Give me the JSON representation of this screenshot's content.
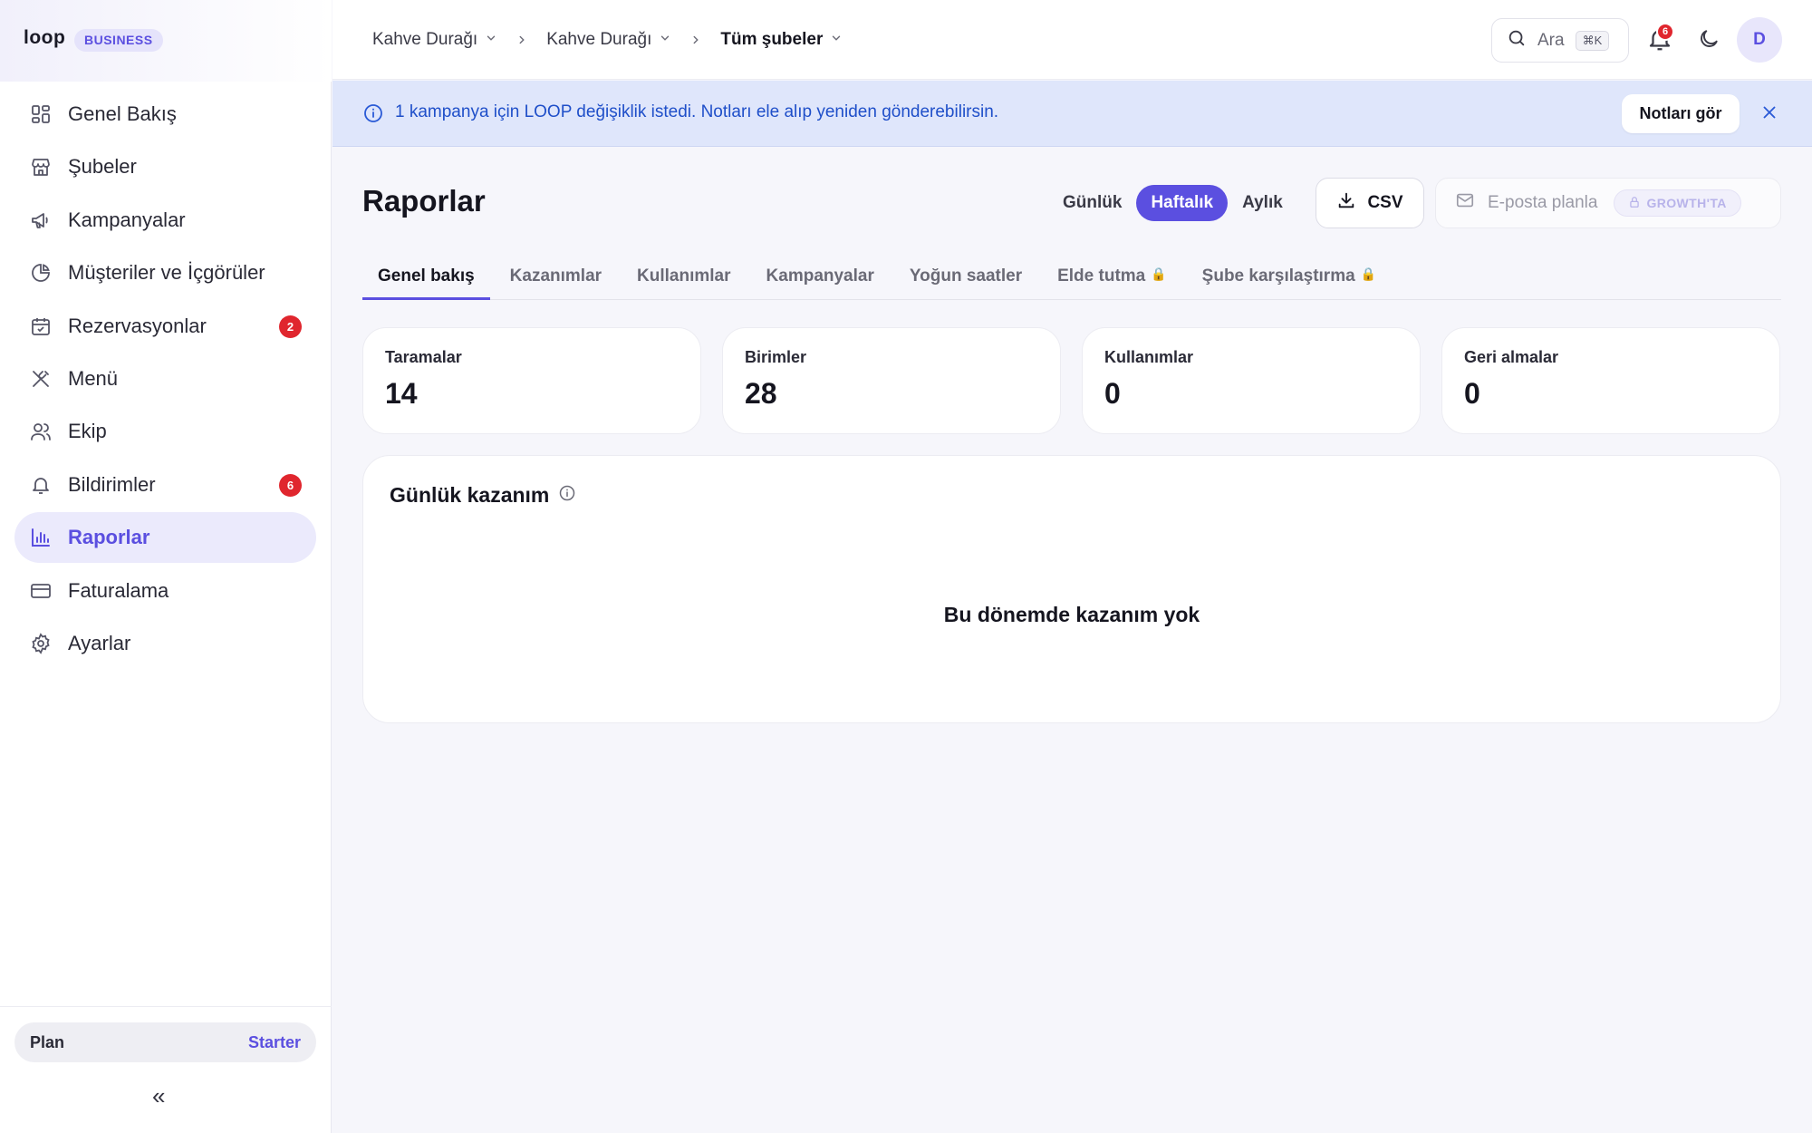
{
  "brand": {
    "logo": "loop",
    "badge": "BUSINESS",
    "accent": "#5b4fe0"
  },
  "sidebar": {
    "items": [
      {
        "label": "Genel Bakış",
        "icon": "grid-icon"
      },
      {
        "label": "Şubeler",
        "icon": "store-icon"
      },
      {
        "label": "Kampanyalar",
        "icon": "megaphone-icon"
      },
      {
        "label": "Müşteriler ve İçgörüler",
        "icon": "pie-chart-icon"
      },
      {
        "label": "Rezervasyonlar",
        "icon": "calendar-check-icon",
        "badge": "2"
      },
      {
        "label": "Menü",
        "icon": "utensils-icon"
      },
      {
        "label": "Ekip",
        "icon": "users-icon"
      },
      {
        "label": "Bildirimler",
        "icon": "bell-icon",
        "badge": "6"
      },
      {
        "label": "Raporlar",
        "icon": "bar-chart-icon",
        "active": true
      },
      {
        "label": "Faturalama",
        "icon": "credit-card-icon"
      },
      {
        "label": "Ayarlar",
        "icon": "gear-icon"
      }
    ],
    "plan": {
      "label": "Plan",
      "value": "Starter"
    },
    "collapse": "«"
  },
  "topbar": {
    "breadcrumbs": [
      "Kahve Durağı",
      "Kahve Durağı",
      "Tüm şubeler"
    ],
    "search": {
      "label": "Ara",
      "shortcut": "⌘K"
    },
    "notifications_count": "6",
    "avatar_initial": "D"
  },
  "banner": {
    "text": "1 kampanya için LOOP değişiklik istedi. Notları ele alıp yeniden gönderebilirsin.",
    "button": "Notları gör"
  },
  "main": {
    "title": "Raporlar",
    "periods": [
      "Günlük",
      "Haftalık",
      "Aylık"
    ],
    "active_period": "Haftalık",
    "csv_label": "CSV",
    "email_label": "E-posta planla",
    "email_lock_label": "GROWTH'TA",
    "tabs": [
      {
        "label": "Genel bakış",
        "active": true
      },
      {
        "label": "Kazanımlar"
      },
      {
        "label": "Kullanımlar"
      },
      {
        "label": "Kampanyalar"
      },
      {
        "label": "Yoğun saatler"
      },
      {
        "label": "Elde tutma",
        "locked": true
      },
      {
        "label": "Şube karşılaştırma",
        "locked": true
      }
    ],
    "stats": [
      {
        "label": "Taramalar",
        "value": "14"
      },
      {
        "label": "Birimler",
        "value": "28"
      },
      {
        "label": "Kullanımlar",
        "value": "0"
      },
      {
        "label": "Geri almalar",
        "value": "0"
      }
    ],
    "card": {
      "title": "Günlük kazanım",
      "empty_text": "Bu dönemde kazanım yok"
    }
  }
}
